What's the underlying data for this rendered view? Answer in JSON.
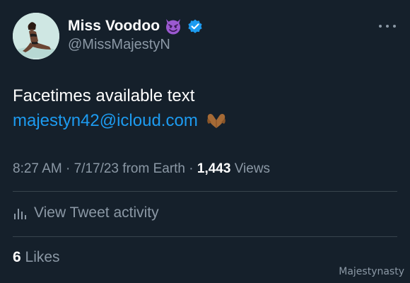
{
  "author": {
    "display_name": "Miss Voodoo",
    "handle": "@MissMajestyN",
    "name_emoji": "smiling-devil-emoji",
    "verified_badge": "verified-badge-icon",
    "avatar": "profile-photo"
  },
  "tweet": {
    "text_line1": "Facetimes available text",
    "link_text": "majestyn42@icloud.com",
    "trailing_emoji": "heart-hands-emoji"
  },
  "meta": {
    "time": "8:27 AM",
    "date": "7/17/23",
    "source": "from Earth",
    "sep": "·",
    "views_count": "1,443",
    "views_label": "Views"
  },
  "activity": {
    "label": "View Tweet activity",
    "icon": "bar-chart-icon"
  },
  "likes": {
    "count": "6",
    "label": "Likes"
  },
  "watermark": "Majestynasty",
  "colors": {
    "background": "#15202b",
    "link": "#1d9bf0",
    "secondary_text": "#8b98a5",
    "divider": "#38444d",
    "verified": "#1d9bf0"
  }
}
